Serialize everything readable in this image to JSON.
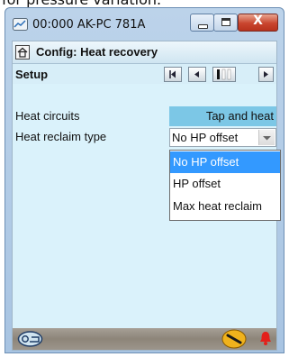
{
  "top_text": "for pressure variation.",
  "window": {
    "title": "00:000 AK-PC 781A",
    "controls": {
      "close_glyph": "X"
    }
  },
  "header": {
    "title": "Config: Heat recovery"
  },
  "setup": {
    "label": "Setup"
  },
  "params": [
    {
      "label": "Heat circuits",
      "value": "Tap and heat"
    },
    {
      "label": "Heat reclaim type",
      "value": "No HP offset"
    }
  ],
  "dropdown": {
    "options": [
      "No HP offset",
      "HP offset",
      "Max heat reclaim"
    ],
    "selected_index": 0
  },
  "icons": {
    "app": "graph-app-icon",
    "home": "home-icon",
    "footer_left": "service-tool-icon",
    "footer_right": "wrench-key-icon",
    "alarm": "alarm-bell-icon"
  },
  "colors": {
    "client_bg": "#daf2fb",
    "value_bg": "#7cc7e6",
    "selected_option": "#3399ff",
    "close_button": "#c9452e"
  }
}
